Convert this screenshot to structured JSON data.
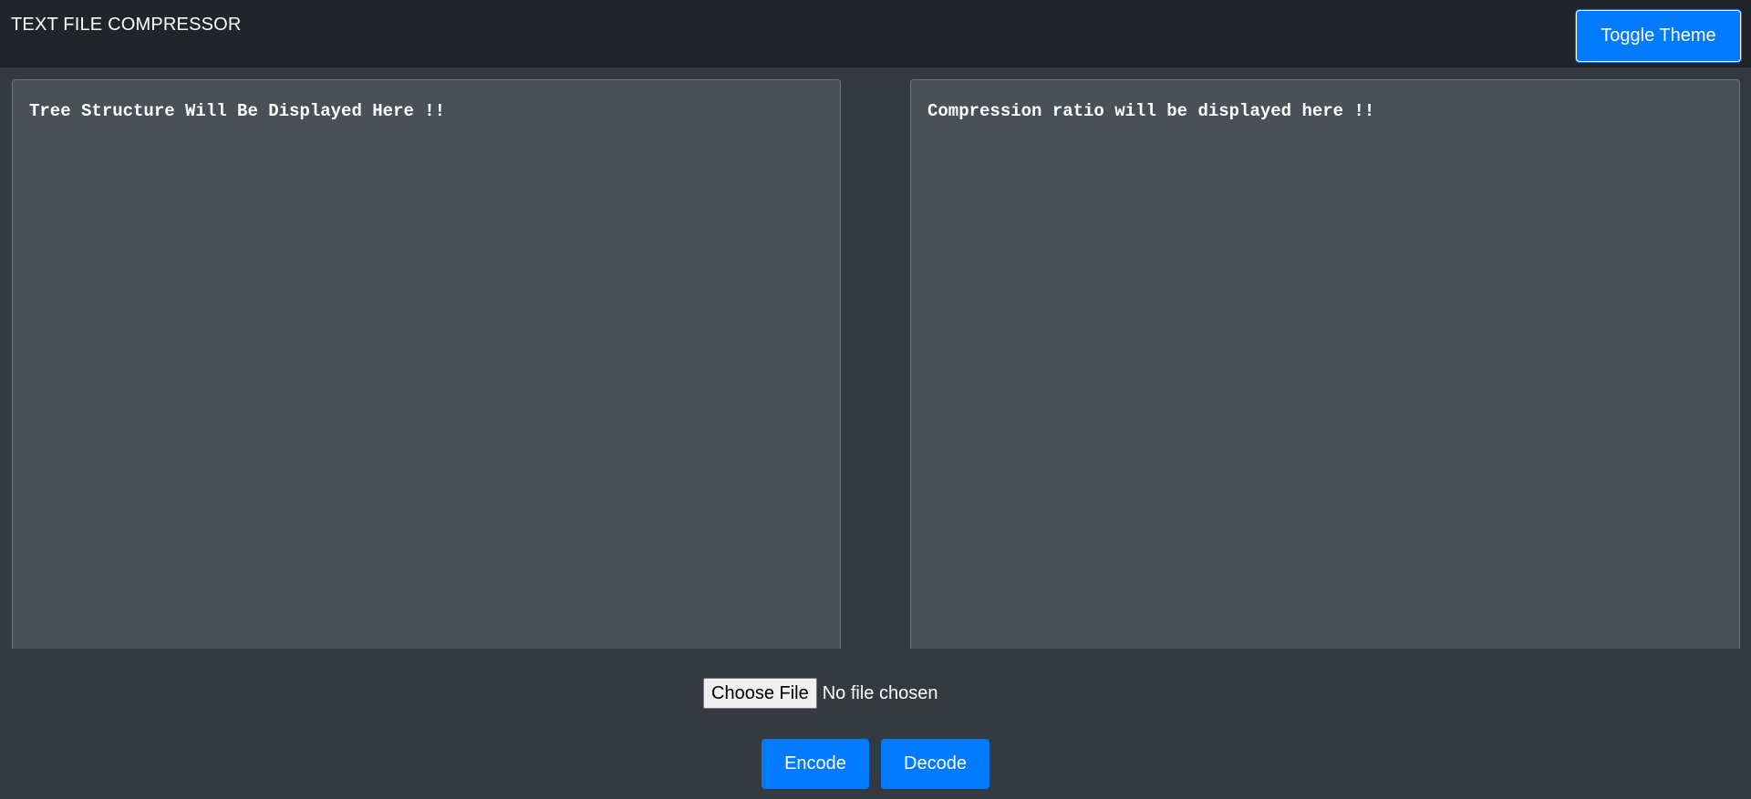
{
  "header": {
    "title": "TEXT FILE COMPRESSOR",
    "toggle_theme_label": "Toggle Theme"
  },
  "panels": {
    "tree_text": "Tree Structure Will Be Displayed Here !!",
    "ratio_text": "Compression ratio will be displayed here !!"
  },
  "file_input": {
    "button_label": "Choose File",
    "status": "No file chosen"
  },
  "actions": {
    "encode_label": "Encode",
    "decode_label": "Decode"
  },
  "colors": {
    "header_bg": "#212529",
    "page_bg": "#343a40",
    "panel_bg": "#495057",
    "accent": "#007bff"
  }
}
